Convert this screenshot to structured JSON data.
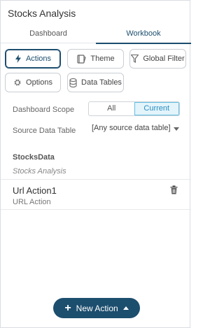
{
  "panel": {
    "title": "Stocks Analysis"
  },
  "tabs": [
    {
      "label": "Dashboard",
      "active": false
    },
    {
      "label": "Workbook",
      "active": true
    }
  ],
  "toolbar": {
    "actions_label": "Actions",
    "theme_label": "Theme",
    "global_filter_label": "Global Filter",
    "options_label": "Options",
    "data_tables_label": "Data Tables",
    "icons": [
      "bolt-icon",
      "theme-icon",
      "filter-icon",
      "gear-icon",
      "database-icon"
    ]
  },
  "scope": {
    "label": "Dashboard Scope",
    "options": [
      "All",
      "Current"
    ],
    "selected": "Current"
  },
  "source": {
    "label": "Source Data Table",
    "value": "[Any source data table]"
  },
  "group": {
    "title": "StocksData",
    "subtitle": "Stocks Analysis"
  },
  "actions_list": [
    {
      "name": "Url Action1",
      "type": "URL Action"
    }
  ],
  "footer": {
    "new_action_label": "New Action"
  },
  "colors": {
    "accent": "#1c4e6e",
    "scope_selected": "#2a8ec0",
    "scope_selected_bg": "#e3f4fb"
  }
}
